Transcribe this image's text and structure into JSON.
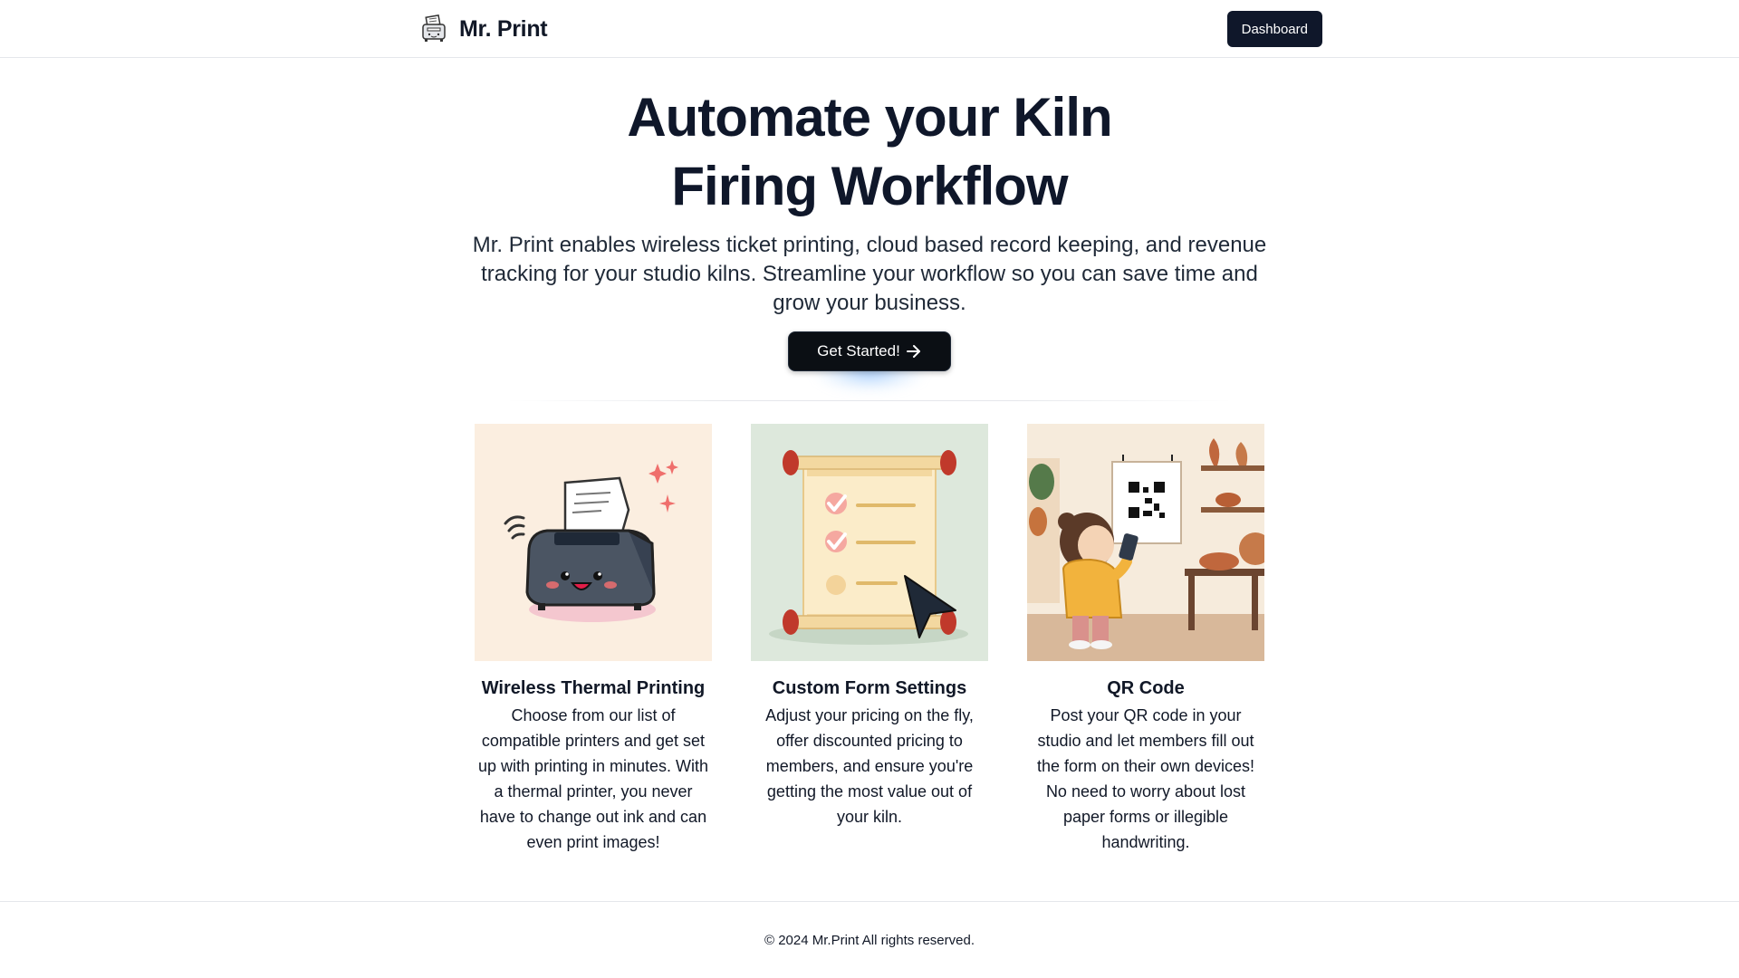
{
  "header": {
    "brand_name": "Mr. Print",
    "brand_icon": "printer-logo-icon",
    "dashboard_label": "Dashboard"
  },
  "hero": {
    "title_line1": "Automate your Kiln",
    "title_line2": "Firing Workflow",
    "subtitle": "Mr. Print enables wireless ticket printing, cloud based record keeping, and revenue tracking for your studio kilns. Streamline your workflow so you can save time and grow your business.",
    "cta_label": "Get Started!",
    "cta_icon": "arrow-right-icon"
  },
  "features": [
    {
      "title": "Wireless Thermal Printing",
      "description": "Choose from our list of compatible printers and get set up with printing in minutes. With a thermal printer, you never have to change out ink and can even print images!",
      "image": "cute-thermal-printer-illustration"
    },
    {
      "title": "Custom Form Settings",
      "description": "Adjust your pricing on the fly, offer discounted pricing to members, and ensure you're getting the most value out of your kiln.",
      "image": "checklist-scroll-with-cursor-illustration"
    },
    {
      "title": "QR Code",
      "description": "Post your QR code in your studio and let members fill out the form on their own devices! No need to worry about lost paper forms or illegible handwriting.",
      "image": "child-scanning-qr-code-illustration"
    }
  ],
  "footer": {
    "copyright": "© 2024 Mr.Print All rights reserved."
  },
  "colors": {
    "primary_dark": "#0f172a",
    "cta_glow": "#60a5fa",
    "border": "#e5e7eb"
  }
}
